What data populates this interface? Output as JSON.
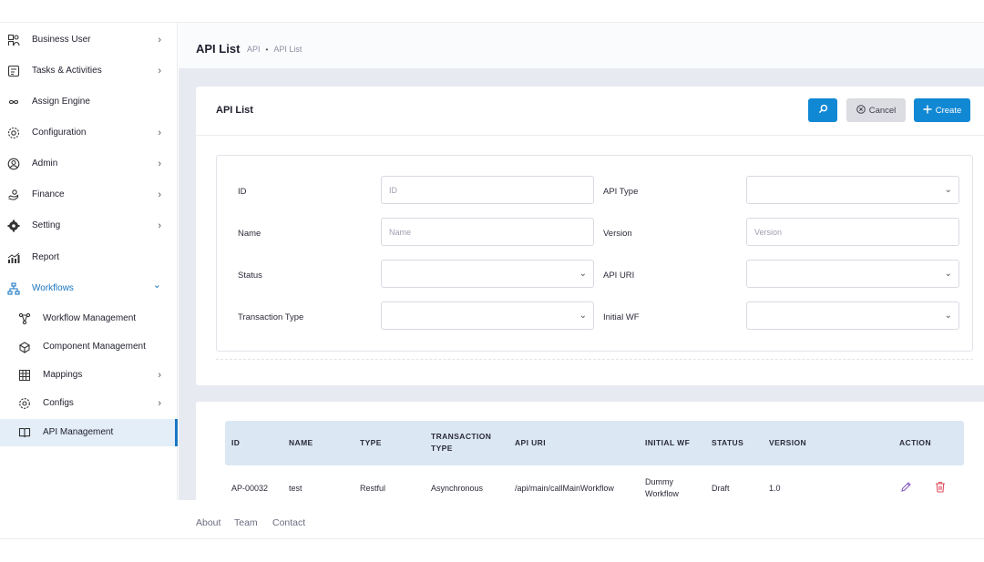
{
  "sidebar": {
    "items": [
      {
        "label": "Business User",
        "icon": "user-group-icon",
        "chevron": "›"
      },
      {
        "label": "Tasks & Activities",
        "icon": "tasks-icon",
        "chevron": "›"
      },
      {
        "label": "Assign Engine",
        "icon": "infinity-icon",
        "chevron": ""
      },
      {
        "label": "Configuration",
        "icon": "gear-outline-icon",
        "chevron": "›"
      },
      {
        "label": "Admin",
        "icon": "user-circle-icon",
        "chevron": "›"
      },
      {
        "label": "Finance",
        "icon": "hand-coin-icon",
        "chevron": "›"
      },
      {
        "label": "Setting",
        "icon": "gear-icon",
        "chevron": "›"
      },
      {
        "label": "Report",
        "icon": "chart-icon",
        "chevron": ""
      },
      {
        "label": "Workflows",
        "icon": "hierarchy-icon",
        "chevron": "⌄"
      }
    ],
    "sub_items": [
      {
        "label": "Workflow Management",
        "icon": "workflow-icon",
        "chevron": ""
      },
      {
        "label": "Component Management",
        "icon": "component-icon",
        "chevron": ""
      },
      {
        "label": "Mappings",
        "icon": "mapping-icon",
        "chevron": "›"
      },
      {
        "label": "Configs",
        "icon": "config-icon",
        "chevron": "›"
      },
      {
        "label": "API Management",
        "icon": "book-icon",
        "chevron": ""
      }
    ]
  },
  "header": {
    "title": "API List",
    "breadcrumb": [
      "API",
      "API List"
    ],
    "breadcrumb_sep": "•"
  },
  "filter_card": {
    "title": "API List",
    "cancel_label": "Cancel",
    "create_label": "Create",
    "fields": {
      "id": {
        "label": "ID",
        "placeholder": "ID"
      },
      "api_type": {
        "label": "API Type",
        "value": ""
      },
      "name": {
        "label": "Name",
        "placeholder": "Name"
      },
      "version": {
        "label": "Version",
        "placeholder": "Version"
      },
      "status": {
        "label": "Status",
        "value": ""
      },
      "api_uri": {
        "label": "API URI",
        "value": ""
      },
      "transaction_type": {
        "label": "Transaction Type",
        "value": ""
      },
      "initial_wf": {
        "label": "Initial WF",
        "value": ""
      }
    }
  },
  "table": {
    "columns": [
      "ID",
      "NAME",
      "TYPE",
      "TRANSACTION TYPE",
      "API URI",
      "INITIAL WF",
      "STATUS",
      "VERSION",
      "ACTION"
    ],
    "rows": [
      {
        "id": "AP-00032",
        "name": "test",
        "type": "Restful",
        "transaction_type": "Asynchronous",
        "api_uri": "/api/main/callMainWorkflow",
        "initial_wf": "Dummy Workflow",
        "status": "Draft",
        "version": "1.0"
      }
    ]
  },
  "footer": {
    "links": [
      "About",
      "Team",
      "Contact"
    ]
  },
  "colors": {
    "accent": "#1188d4",
    "nav_active": "#1976c2",
    "delete": "#e0505e",
    "edit": "#8a5cc4"
  }
}
